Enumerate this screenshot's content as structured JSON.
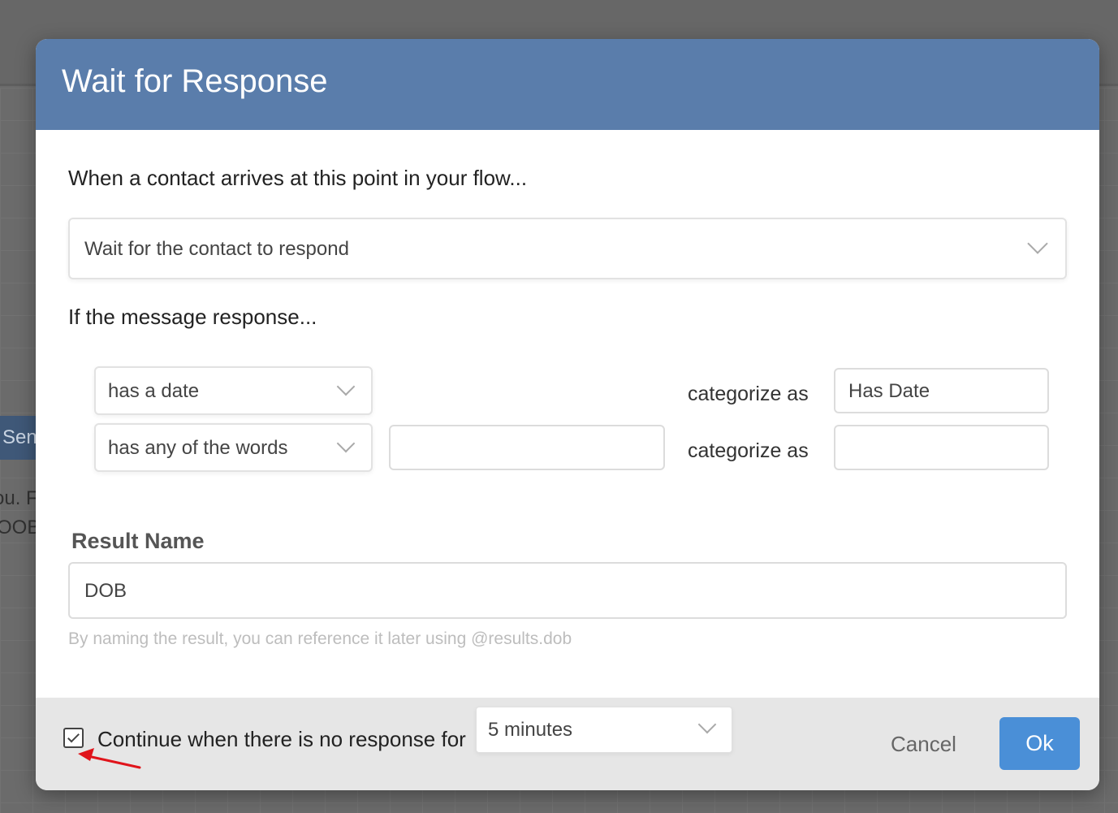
{
  "background": {
    "node_header_text": "Sen",
    "node_text_line1": "ou. F",
    "node_text_line2": "OOB"
  },
  "modal": {
    "title": "Wait for Response",
    "arrives_label": "When a contact arrives at this point in your flow...",
    "wait_select_value": "Wait for the contact to respond",
    "if_label": "If the message response...",
    "rules": [
      {
        "operator": "has a date",
        "argument": "",
        "categorize_label": "categorize as",
        "category": "Has Date"
      },
      {
        "operator": "has any of the words",
        "argument": "",
        "categorize_label": "categorize as",
        "category": ""
      }
    ],
    "result_name_label": "Result Name",
    "result_name_value": "DOB",
    "result_hint": "By naming the result, you can reference it later using @results.dob"
  },
  "footer": {
    "continue_checked": true,
    "continue_label": "Continue when there is no response for",
    "timeout_value": "5 minutes",
    "cancel_label": "Cancel",
    "ok_label": "Ok"
  },
  "colors": {
    "header": "#5a7dab",
    "ok_button": "#4a8fd7",
    "annotation_arrow": "#e0141b"
  },
  "icons": {
    "dropdown": "chevron-down-icon",
    "checkbox": "check-icon",
    "annotation": "red-arrow-icon"
  }
}
